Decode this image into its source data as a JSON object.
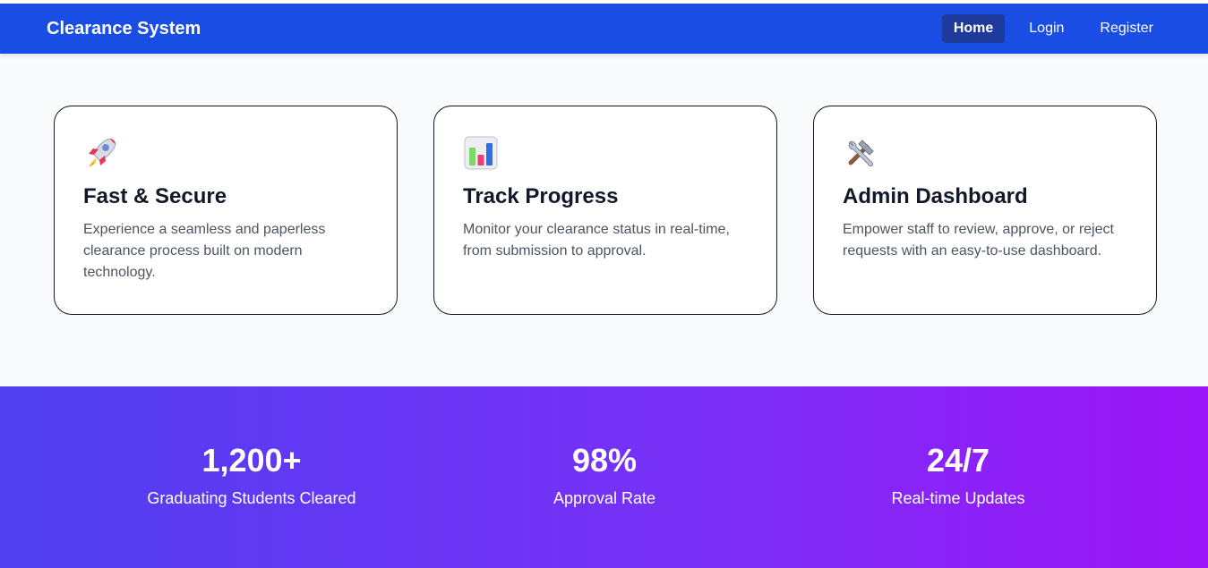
{
  "nav": {
    "brand": "Clearance System",
    "links": [
      {
        "label": "Home",
        "active": true
      },
      {
        "label": "Login",
        "active": false
      },
      {
        "label": "Register",
        "active": false
      }
    ]
  },
  "features": [
    {
      "icon": "rocket-icon",
      "title": "Fast & Secure",
      "text": "Experience a seamless and paperless clearance process built on modern technology."
    },
    {
      "icon": "bar-chart-icon",
      "title": "Track Progress",
      "text": "Monitor your clearance status in real-time, from submission to approval."
    },
    {
      "icon": "tools-icon",
      "title": "Admin Dashboard",
      "text": "Empower staff to review, approve, or reject requests with an easy-to-use dashboard."
    }
  ],
  "stats": [
    {
      "value": "1,200+",
      "label": "Graduating Students Cleared"
    },
    {
      "value": "98%",
      "label": "Approval Rate"
    },
    {
      "value": "24/7",
      "label": "Real-time Updates"
    }
  ],
  "colors": {
    "navbar": "#1a4de3",
    "active_link": "#1e3a9a",
    "gradient_start": "#4f3ff0",
    "gradient_end": "#9b14f7"
  }
}
